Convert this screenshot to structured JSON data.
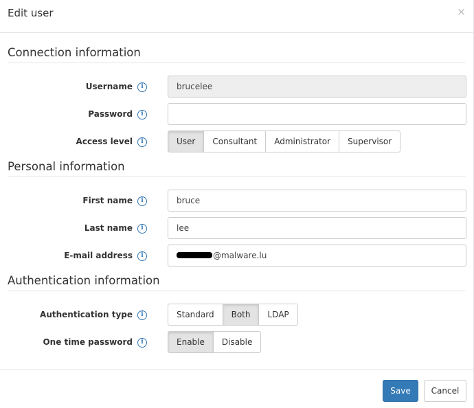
{
  "dialog": {
    "title": "Edit user",
    "close_glyph": "×"
  },
  "sections": {
    "connection": "Connection information",
    "personal": "Personal information",
    "authentication": "Authentication information"
  },
  "info_icon_glyph": "i",
  "fields": {
    "username": {
      "label": "Username",
      "value": "brucelee",
      "disabled": true
    },
    "password": {
      "label": "Password",
      "value": ""
    },
    "access_level": {
      "label": "Access level",
      "options": [
        "User",
        "Consultant",
        "Administrator",
        "Supervisor"
      ],
      "selected": "User"
    },
    "first_name": {
      "label": "First name",
      "value": "bruce"
    },
    "last_name": {
      "label": "Last name",
      "value": "lee"
    },
    "email": {
      "label": "E-mail address",
      "value_visible_suffix": "@malware.lu",
      "redacted_prefix": true
    },
    "auth_type": {
      "label": "Authentication type",
      "options": [
        "Standard",
        "Both",
        "LDAP"
      ],
      "selected": "Both"
    },
    "otp": {
      "label": "One time password",
      "options": [
        "Enable",
        "Disable"
      ],
      "selected": "Enable"
    }
  },
  "footer": {
    "save_label": "Save",
    "cancel_label": "Cancel"
  },
  "colors": {
    "primary": "#337ab7",
    "info_icon": "#3277b5",
    "border": "#cccccc"
  }
}
